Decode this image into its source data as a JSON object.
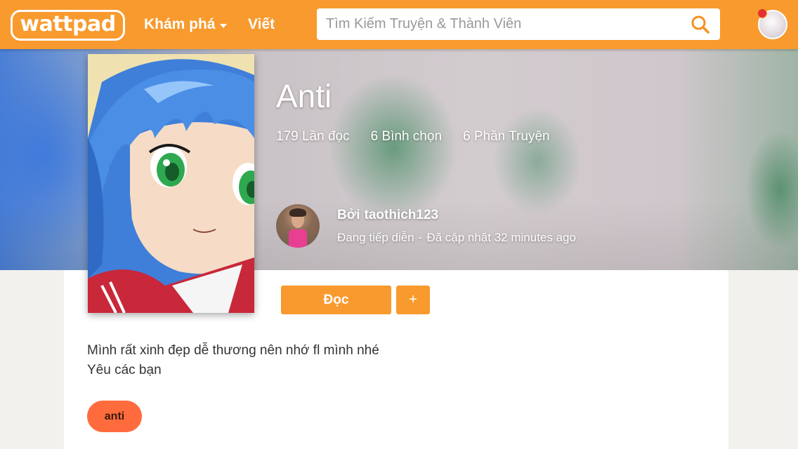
{
  "header": {
    "logo_text": "wattpad",
    "discover_label": "Khám phá",
    "write_label": "Viết",
    "search": {
      "placeholder": "Tìm Kiếm Truyện & Thành Viên",
      "value": ""
    }
  },
  "story": {
    "title": "Anti",
    "reads": "179 Lần đọc",
    "votes": "6 Bình chọn",
    "parts": "6 Phần Truyện",
    "author_prefix": "Bởi",
    "author_name": "taothich123",
    "status": "Đang tiếp diễn",
    "separator": "-",
    "updated": "Đã cập nhật 32 minutes ago",
    "read_button": "Đọc",
    "add_button": "+",
    "description_lines": [
      "Mình rất xinh đẹp dễ thương nên nhớ fl mình nhé",
      "Yêu các bạn"
    ],
    "tags": [
      "anti"
    ]
  },
  "colors": {
    "brand_orange": "#f89a2e",
    "tag_orange": "#ff6b3d",
    "notification_red": "#e5312f"
  }
}
